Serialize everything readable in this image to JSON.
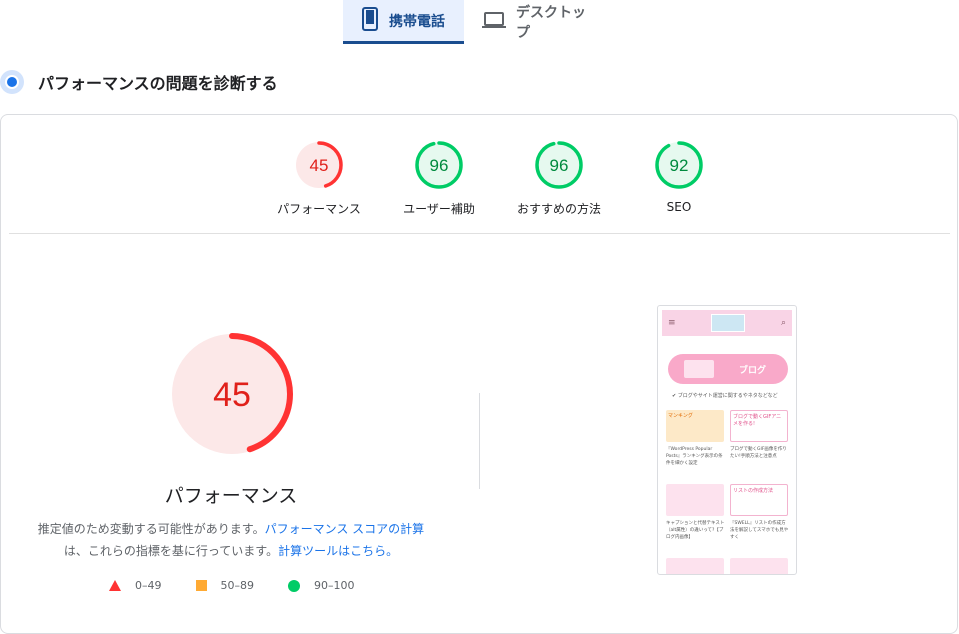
{
  "tabs": [
    {
      "label": "携帯電話",
      "icon": "mobile-icon",
      "active": true
    },
    {
      "label": "デスクトップ",
      "icon": "laptop-icon",
      "active": false
    }
  ],
  "section": {
    "title": "パフォーマンスの問題を診断する",
    "icon": "diagnose-icon"
  },
  "scores": [
    {
      "label": "パフォーマンス",
      "value": "45",
      "ring": 0.45,
      "status": "fail"
    },
    {
      "label": "ユーザー補助",
      "value": "96",
      "ring": 0.96,
      "status": "pass"
    },
    {
      "label": "おすすめの方法",
      "value": "96",
      "ring": 0.96,
      "status": "pass"
    },
    {
      "label": "SEO",
      "value": "92",
      "ring": 0.92,
      "status": "pass"
    }
  ],
  "main_score": {
    "value": "45",
    "ring": 0.45,
    "label": "パフォーマンス"
  },
  "description": {
    "part1": "推定値のため変動する可能性があります。",
    "link1": "パフォーマンス スコアの計算",
    "part2": "は、これらの指標を基に行っています。",
    "link2": "計算ツールはこちら。"
  },
  "legend": [
    {
      "range": "0–49",
      "shape": "triangle"
    },
    {
      "range": "50–89",
      "shape": "square"
    },
    {
      "range": "90–100",
      "shape": "circle"
    }
  ],
  "colors": {
    "fail": "#ff3333",
    "fail_bg": "#fce8e8",
    "average": "#ffaa33",
    "pass": "#00cc66",
    "pass_bg": "#e6f9ef",
    "accent": "#1a4d8f",
    "link": "#1a73e8"
  },
  "screenshot": {
    "banner": "ブログ",
    "subtitle": "✔ ブログやサイト運営に関するやネタなどなど",
    "thumb_titles": [
      "マンキング",
      "ブログで動くGIFアニメを作る!",
      "",
      "リストの作成方法"
    ],
    "captions": [
      "『WordPress Popular Posts』ランキング表示の条件を細かく設定",
      "ブログで動くGIF画像を作りたい!手順方法と注意点",
      "キャプションと代替テキスト（alt属性）の違いって?【ブログ内画像】",
      "『SWELL』リストの作成方法を解説してスマホでも見やすく"
    ]
  }
}
